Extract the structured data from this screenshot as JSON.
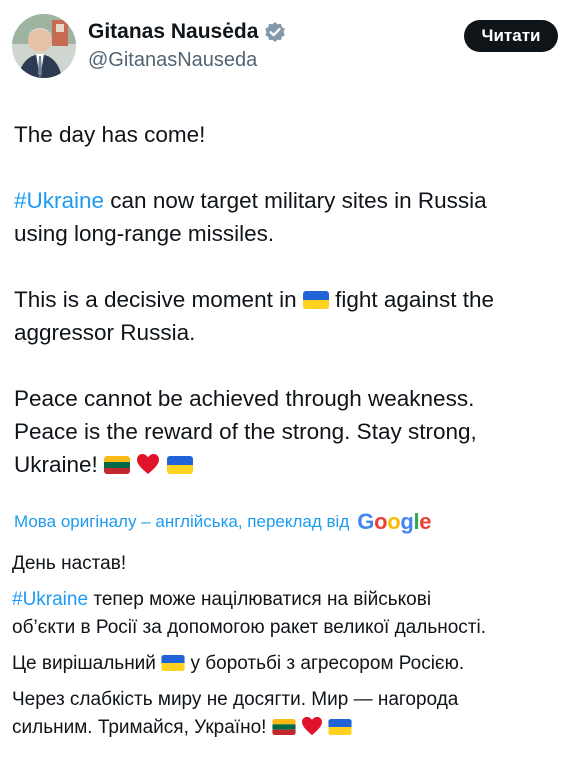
{
  "header": {
    "display_name": "Gitanas Nausėda",
    "handle": "@GitanasNauseda",
    "read_button": "Читати"
  },
  "tweet": {
    "line1": "The day has come!",
    "hashtag": "#Ukraine",
    "para2_rest": " can now target military sites in Russia",
    "para2_line2": "using long-range missiles.",
    "para3_a": "This is a decisive moment in ",
    "para3_b": " fight against the",
    "para3_line2": "aggressor Russia.",
    "para4_line1": "Peace cannot be achieved through weakness.",
    "para4_line2": "Peace is the reward of the strong. Stay strong,",
    "para4_line3": "Ukraine! "
  },
  "translation_note": {
    "text": "Мова оригіналу – англійська, переклад від",
    "google": [
      "G",
      "o",
      "o",
      "g",
      "l",
      "e"
    ],
    "google_colors": [
      "#4285f4",
      "#ea4335",
      "#fbbc05",
      "#4285f4",
      "#34a853",
      "#ea4335"
    ]
  },
  "translation": {
    "line1": "День настав!",
    "hashtag": "#Ukraine",
    "para2_rest": " тепер може націлюватися на військові",
    "para2_line2": "об’єкти в Росії за допомогою ракет великої дальності.",
    "para3_a": "Це вирішальний ",
    "para3_b": " у боротьбі з агресором Росією.",
    "para4_line1": "Через слабкість миру не досягти. Мир — нагорода",
    "para4_line2": "сильним. Тримайся, Україно! "
  },
  "colors": {
    "hashtag": "#1d9bf0",
    "verified_badge": "#829aab",
    "button_bg": "#0f1419"
  }
}
